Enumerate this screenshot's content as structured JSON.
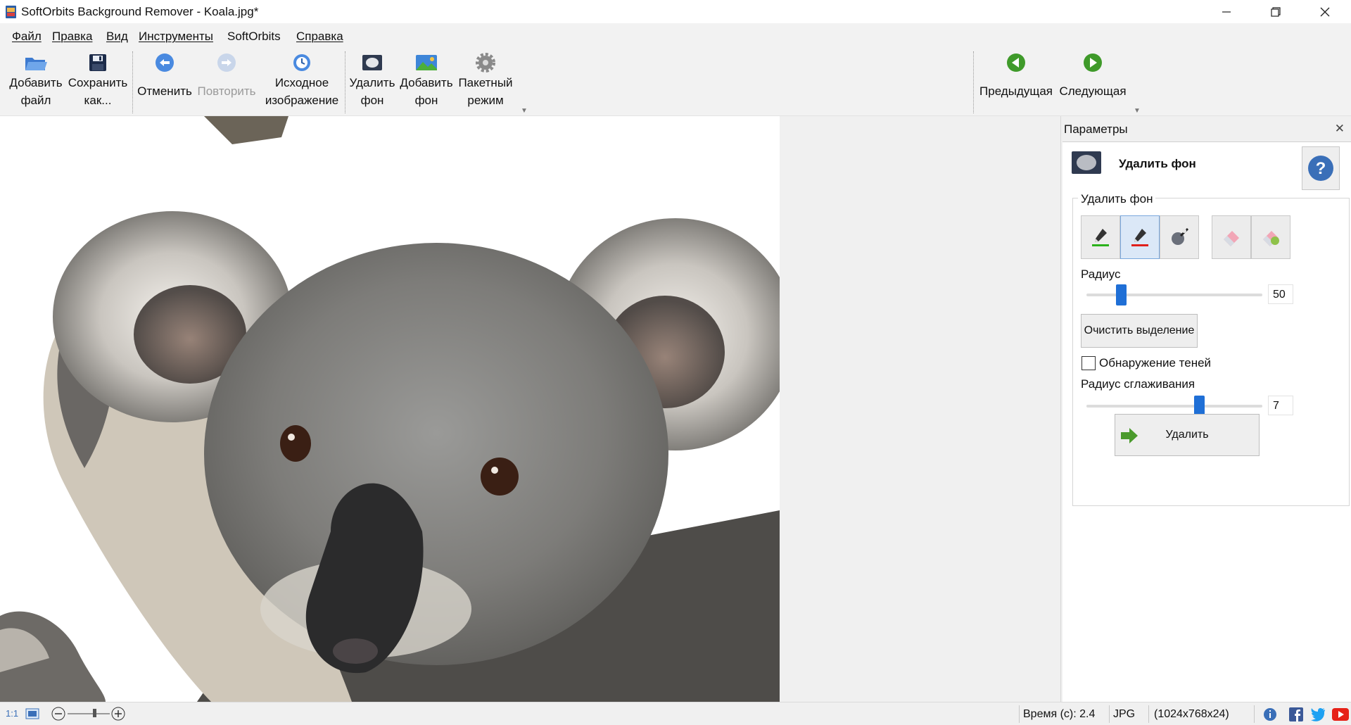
{
  "window": {
    "title": "SoftOrbits Background Remover - Koala.jpg*",
    "controls": [
      "minimize-icon",
      "restore-icon",
      "close-icon"
    ]
  },
  "menu": {
    "items": [
      "Файл",
      "Правка",
      "Вид",
      "Инструменты",
      "SoftOrbits",
      "Справка"
    ]
  },
  "toolbar": {
    "add_file": "Добавить\nфайл",
    "save_as": "Сохранить\nкак...",
    "undo": "Отменить",
    "redo": "Повторить",
    "original": "Исходное\nизображение",
    "remove_bg": "Удалить\nфон",
    "add_bg": "Добавить\nфон",
    "batch": "Пакетный\nрежим",
    "previous": "Предыдущая",
    "next": "Следующая"
  },
  "panel": {
    "title": "Параметры",
    "tool_title": "Удалить фон",
    "group_label": "Удалить фон",
    "radius_label": "Радиус",
    "radius_value": "50",
    "radius_fraction": 0.18,
    "clear_button": "Очистить выделение",
    "shadow_label": "Обнаружение теней",
    "shadow_checked": false,
    "smoothing_label": "Радиус сглаживания",
    "smoothing_value": "7",
    "smoothing_fraction": 0.65,
    "remove_button": "Удалить"
  },
  "status": {
    "zoom_label": "1:1",
    "time": "Время (с): 2.4",
    "format": "JPG",
    "dimensions": "(1024x768x24)"
  },
  "colors": {
    "accent_blue": "#1f6fd6",
    "nav_green": "#3f9a2a",
    "marker_green": "#2bb21b",
    "marker_red": "#e0201b"
  }
}
